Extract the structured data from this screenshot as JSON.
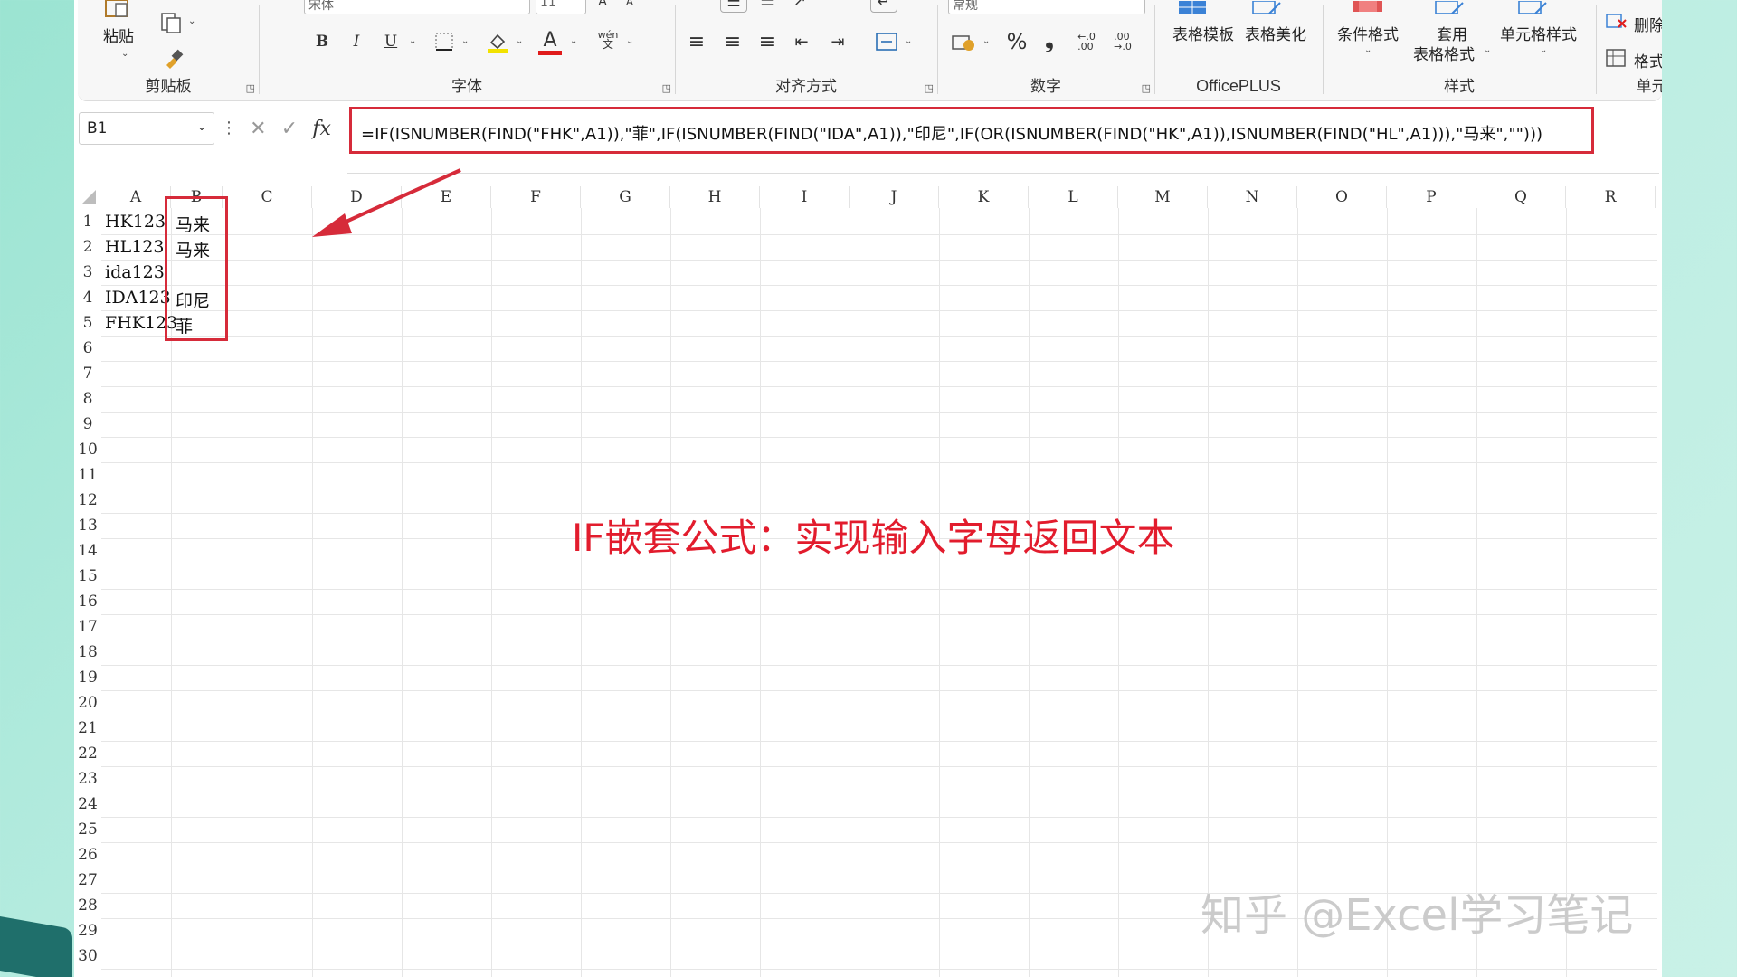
{
  "ribbon": {
    "clipboard": {
      "paste": "粘贴",
      "label": "剪贴板"
    },
    "font": {
      "font_name": "宋体",
      "font_size": "11",
      "label": "字体",
      "bold": "B",
      "italic": "I",
      "underline": "U",
      "font_color_glyph": "A",
      "phonetic": "wén"
    },
    "alignment": {
      "label": "对齐方式"
    },
    "number": {
      "format": "常规",
      "label": "数字",
      "percent": "%",
      "comma": "❟",
      "inc_decimal": "←.0\n.00",
      "dec_decimal": ".00\n→.0"
    },
    "officeplus": {
      "template": "表格模板",
      "beautify": "表格美化",
      "label": "OfficePLUS"
    },
    "styles": {
      "conditional": "条件格式",
      "table_format_1": "套用",
      "table_format_2": "表格格式",
      "cell_styles": "单元格样式",
      "label": "样式"
    },
    "cells": {
      "delete": "删除",
      "format": "格式",
      "label": "单元格"
    }
  },
  "formula_bar": {
    "name_box": "B1",
    "fx": "fx",
    "formula": "=IF(ISNUMBER(FIND(\"FHK\",A1)),\"菲\",IF(ISNUMBER(FIND(\"IDA\",A1)),\"印尼\",IF(OR(ISNUMBER(FIND(\"HK\",A1)),ISNUMBER(FIND(\"HL\",A1))),\"马来\",\"\")))"
  },
  "sheet": {
    "columns": [
      "A",
      "B",
      "C",
      "D",
      "E",
      "F",
      "G",
      "H",
      "I",
      "J",
      "K",
      "L",
      "M",
      "N",
      "O",
      "P",
      "Q",
      "R"
    ],
    "rows": [
      "1",
      "2",
      "3",
      "4",
      "5",
      "6",
      "7",
      "8",
      "9",
      "10",
      "11",
      "12",
      "13",
      "14",
      "15",
      "16",
      "17",
      "18",
      "19",
      "20",
      "21",
      "22",
      "23",
      "24",
      "25",
      "26",
      "27",
      "28",
      "29",
      "30"
    ],
    "data": [
      {
        "a": "HK123",
        "b": "马来"
      },
      {
        "a": "HL123",
        "b": "马来"
      },
      {
        "a": "ida123",
        "b": ""
      },
      {
        "a": "IDA123",
        "b": "印尼"
      },
      {
        "a": "FHK123",
        "b": "菲"
      }
    ]
  },
  "caption": "IF嵌套公式：实现输入字母返回文本",
  "watermark": "知乎 @Excel学习笔记",
  "colors": {
    "highlight": "#d62b3a",
    "caption": "#e21c2d"
  }
}
